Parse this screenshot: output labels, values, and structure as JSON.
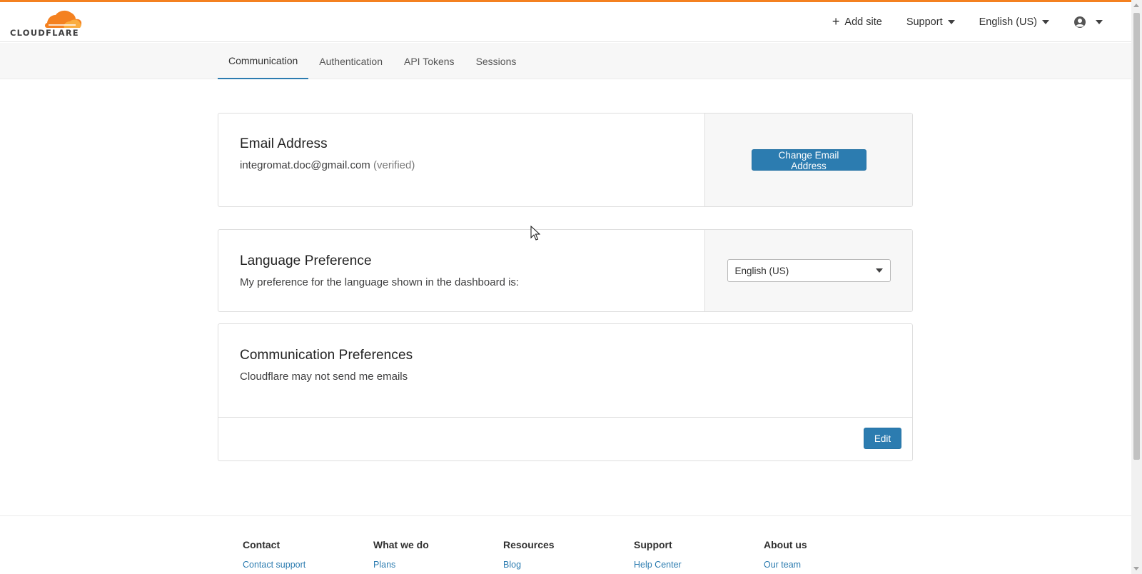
{
  "brand": {
    "name": "CLOUDFLARE",
    "accent": "#f48120",
    "link_color": "#2c7cb0"
  },
  "header": {
    "add_site": "Add site",
    "support": "Support",
    "language": "English (US)",
    "account_icon": "user-circle-icon"
  },
  "tabs": [
    {
      "label": "Communication",
      "active": true
    },
    {
      "label": "Authentication",
      "active": false
    },
    {
      "label": "API Tokens",
      "active": false
    },
    {
      "label": "Sessions",
      "active": false
    }
  ],
  "email_card": {
    "title": "Email Address",
    "email": "integromat.doc@gmail.com",
    "status": "(verified)",
    "button": "Change Email Address"
  },
  "language_card": {
    "title": "Language Preference",
    "description": "My preference for the language shown in the dashboard is:",
    "selected": "English (US)"
  },
  "comm_card": {
    "title": "Communication Preferences",
    "description": "Cloudflare may not send me emails",
    "button": "Edit"
  },
  "footer": {
    "columns": [
      {
        "heading": "Contact",
        "link": "Contact support"
      },
      {
        "heading": "What we do",
        "link": "Plans"
      },
      {
        "heading": "Resources",
        "link": "Blog"
      },
      {
        "heading": "Support",
        "link": "Help Center"
      },
      {
        "heading": "About us",
        "link": "Our team"
      }
    ]
  }
}
